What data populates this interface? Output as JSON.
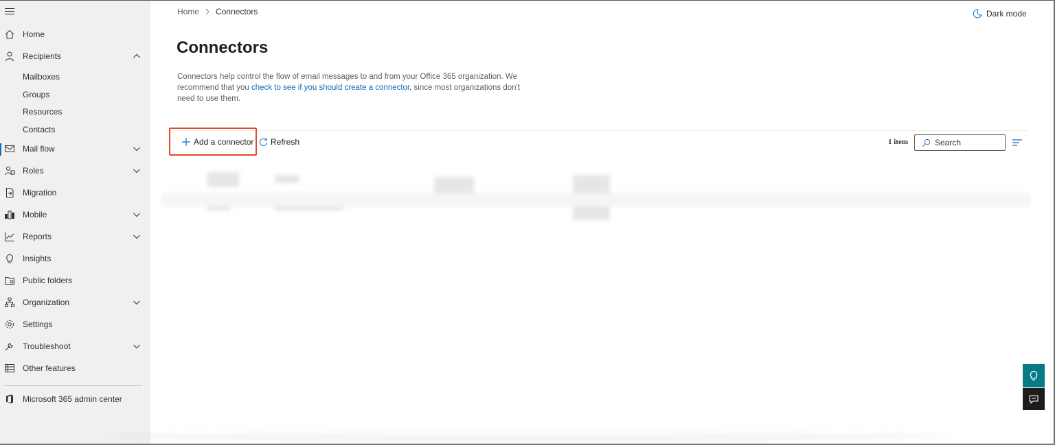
{
  "sidebar": {
    "items": [
      {
        "id": "home",
        "label": "Home",
        "icon": "home-icon",
        "expandable": false
      },
      {
        "id": "recipients",
        "label": "Recipients",
        "icon": "person-icon",
        "expandable": true,
        "expanded": true
      },
      {
        "id": "mail-flow",
        "label": "Mail flow",
        "icon": "mail-icon",
        "expandable": true,
        "active": true
      },
      {
        "id": "roles",
        "label": "Roles",
        "icon": "roles-icon",
        "expandable": true
      },
      {
        "id": "migration",
        "label": "Migration",
        "icon": "migration-icon",
        "expandable": false
      },
      {
        "id": "mobile",
        "label": "Mobile",
        "icon": "mobile-icon",
        "expandable": true
      },
      {
        "id": "reports",
        "label": "Reports",
        "icon": "reports-icon",
        "expandable": true
      },
      {
        "id": "insights",
        "label": "Insights",
        "icon": "lightbulb-icon",
        "expandable": false
      },
      {
        "id": "public-folders",
        "label": "Public folders",
        "icon": "folder-icon",
        "expandable": false
      },
      {
        "id": "organization",
        "label": "Organization",
        "icon": "org-chart-icon",
        "expandable": true
      },
      {
        "id": "settings",
        "label": "Settings",
        "icon": "gear-icon",
        "expandable": false
      },
      {
        "id": "troubleshoot",
        "label": "Troubleshoot",
        "icon": "wrench-icon",
        "expandable": true
      },
      {
        "id": "other-features",
        "label": "Other features",
        "icon": "grid-icon",
        "expandable": false
      }
    ],
    "recipients_sub": [
      "Mailboxes",
      "Groups",
      "Resources",
      "Contacts"
    ],
    "admin_center": {
      "label": "Microsoft 365 admin center",
      "icon": "office-icon"
    }
  },
  "breadcrumb": {
    "home": "Home",
    "current": "Connectors"
  },
  "dark_mode_label": "Dark mode",
  "page": {
    "title": "Connectors",
    "desc_before": "Connectors help control the flow of email messages to and from your Office 365 organization. We recommend that you ",
    "desc_link": "check to see if you should create a connector",
    "desc_after": ", since most organizations don't need to use them."
  },
  "toolbar": {
    "add_label": "Add a connector",
    "refresh_label": "Refresh",
    "item_count": "1 item",
    "search_placeholder": "Search"
  },
  "colors": {
    "accent": "#0f6cbd",
    "highlight_border": "#e04a2a",
    "help_button": "#077a86",
    "chat_button": "#1c1c1c"
  }
}
